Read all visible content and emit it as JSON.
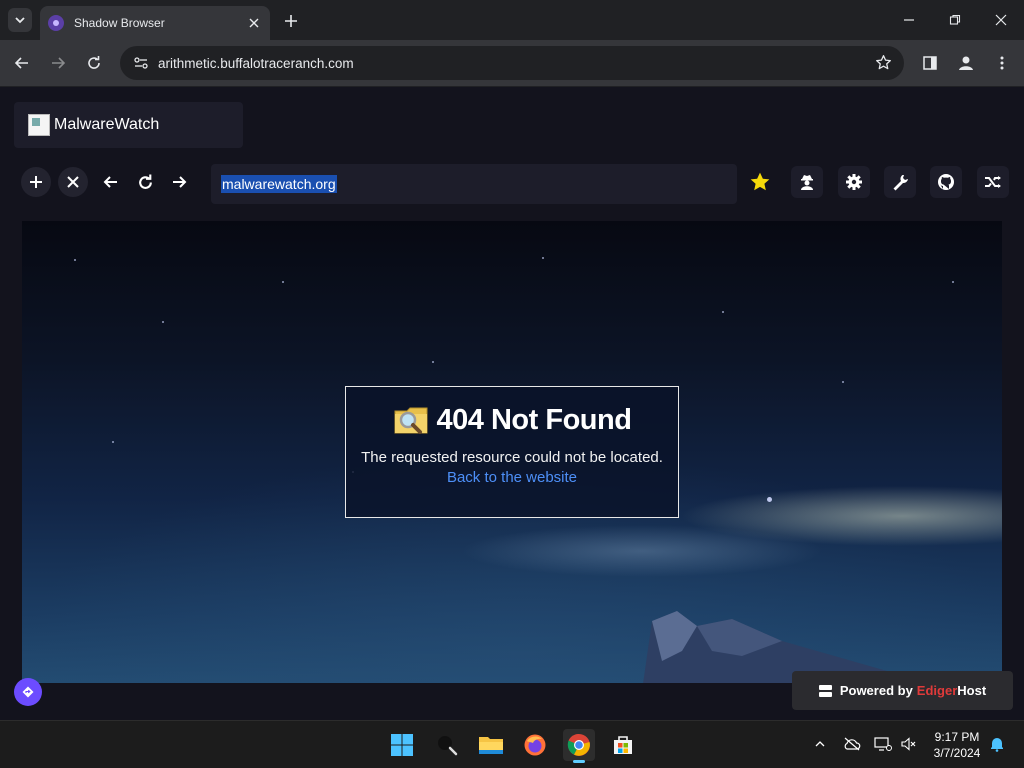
{
  "browser": {
    "tab_title": "Shadow Browser",
    "address": "arithmetic.buffalotraceranch.com"
  },
  "app": {
    "brand_name": "MalwareWatch",
    "search_value": "malwarewatch.org",
    "toolbar_icons": [
      "plus-icon",
      "close-icon",
      "arrow-left-icon",
      "refresh-icon",
      "arrow-right-icon"
    ],
    "right_icons": [
      "star-icon",
      "user-secret-icon",
      "gear-icon",
      "wrench-icon",
      "github-icon",
      "shuffle-icon"
    ],
    "colors": {
      "accent": "#6c4cff",
      "star": "#f5d90a",
      "link": "#4d8ff7",
      "selection": "#1a4fb0"
    }
  },
  "error": {
    "title": "404 Not Found",
    "message": "The requested resource could not be located.",
    "link_label": "Back to the website"
  },
  "footer": {
    "powered_by": "Powered by",
    "host_a": "Ediger",
    "host_b": "Host"
  },
  "taskbar": {
    "apps": [
      "windows-start-icon",
      "search-icon",
      "file-explorer-icon",
      "firefox-icon",
      "chrome-icon",
      "microsoft-store-icon"
    ],
    "time": "9:17 PM",
    "date": "3/7/2024"
  }
}
